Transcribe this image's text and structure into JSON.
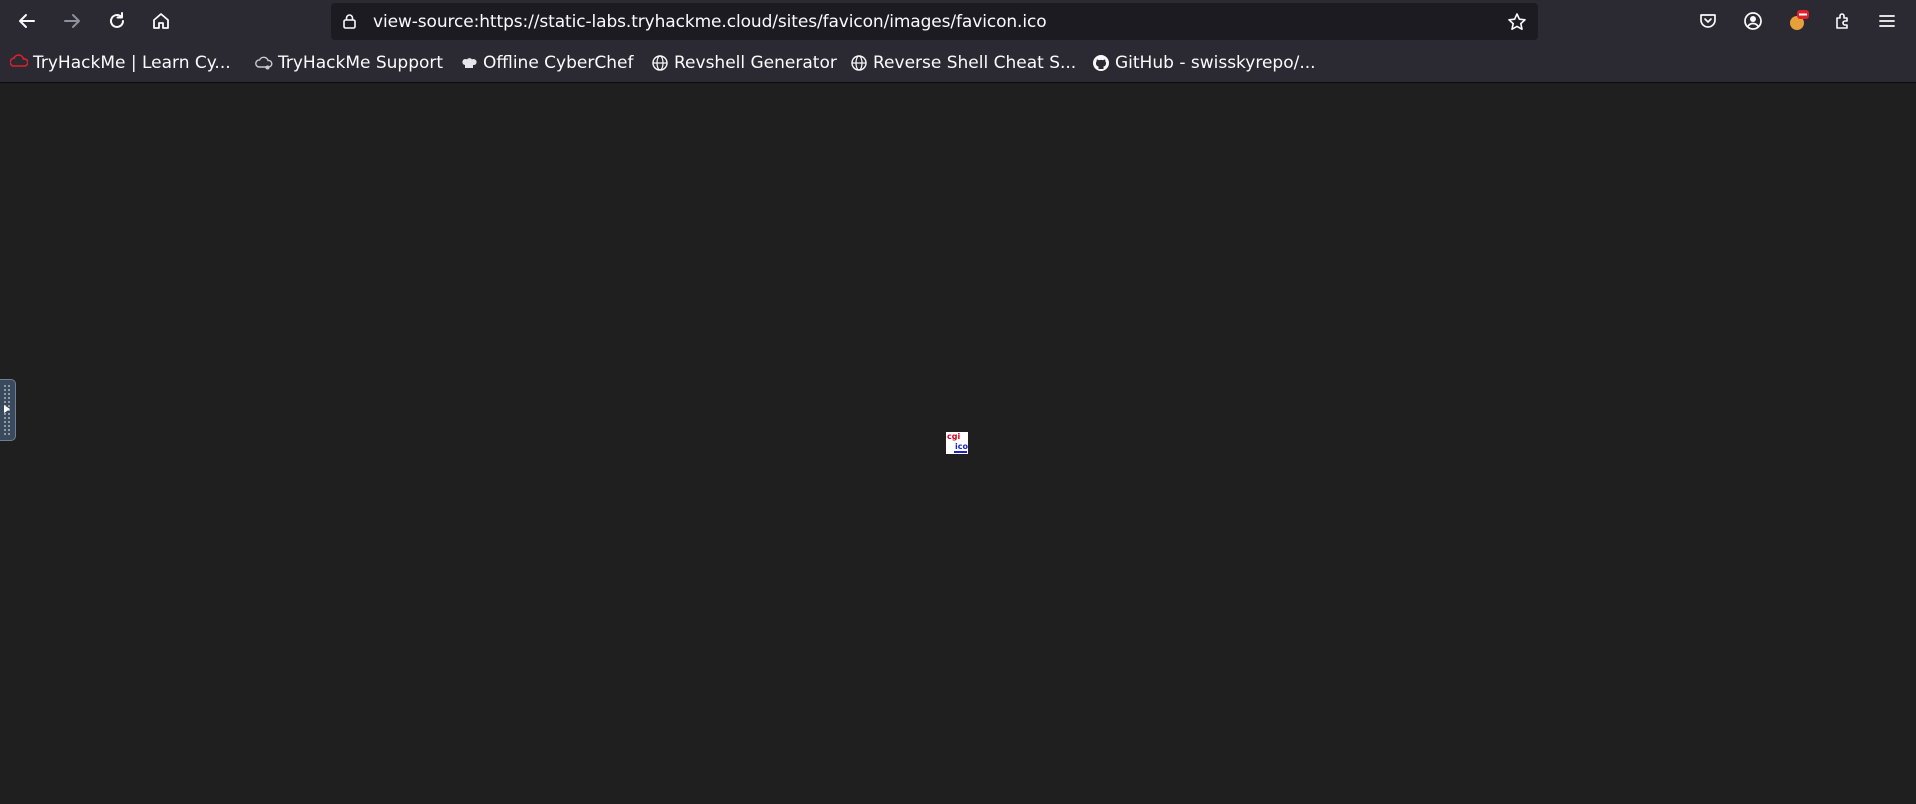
{
  "browser": {
    "url": "view-source:https://static-labs.tryhackme.cloud/sites/favicon/images/favicon.ico",
    "nav_icons": [
      "back-icon",
      "forward-icon",
      "reload-icon",
      "home-icon"
    ],
    "url_icons": [
      "lock-icon",
      "star-icon"
    ],
    "toolbar_icons": [
      "pocket-icon",
      "account-icon",
      "extension-badge-icon",
      "extensions-icon",
      "menu-icon"
    ]
  },
  "bookmarks": [
    {
      "label": "TryHackMe | Learn Cy...",
      "icon": "tryhackme-icon"
    },
    {
      "label": "TryHackMe Support",
      "icon": "cloud-icon"
    },
    {
      "label": "Offline CyberChef",
      "icon": "chef-hat-icon"
    },
    {
      "label": "Revshell Generator",
      "icon": "globe-icon"
    },
    {
      "label": "Reverse Shell Cheat S...",
      "icon": "globe-icon"
    },
    {
      "label": "GitHub - swisskyrepo/...",
      "icon": "github-icon"
    }
  ],
  "content": {
    "background": "#1f1f1f",
    "image_label_top": "cgi",
    "image_label_bottom": "ico"
  },
  "colors": {
    "toolbar": "#2b2a33",
    "urlbar": "#1c1b22",
    "tryhackme_red": "#e0202a"
  }
}
